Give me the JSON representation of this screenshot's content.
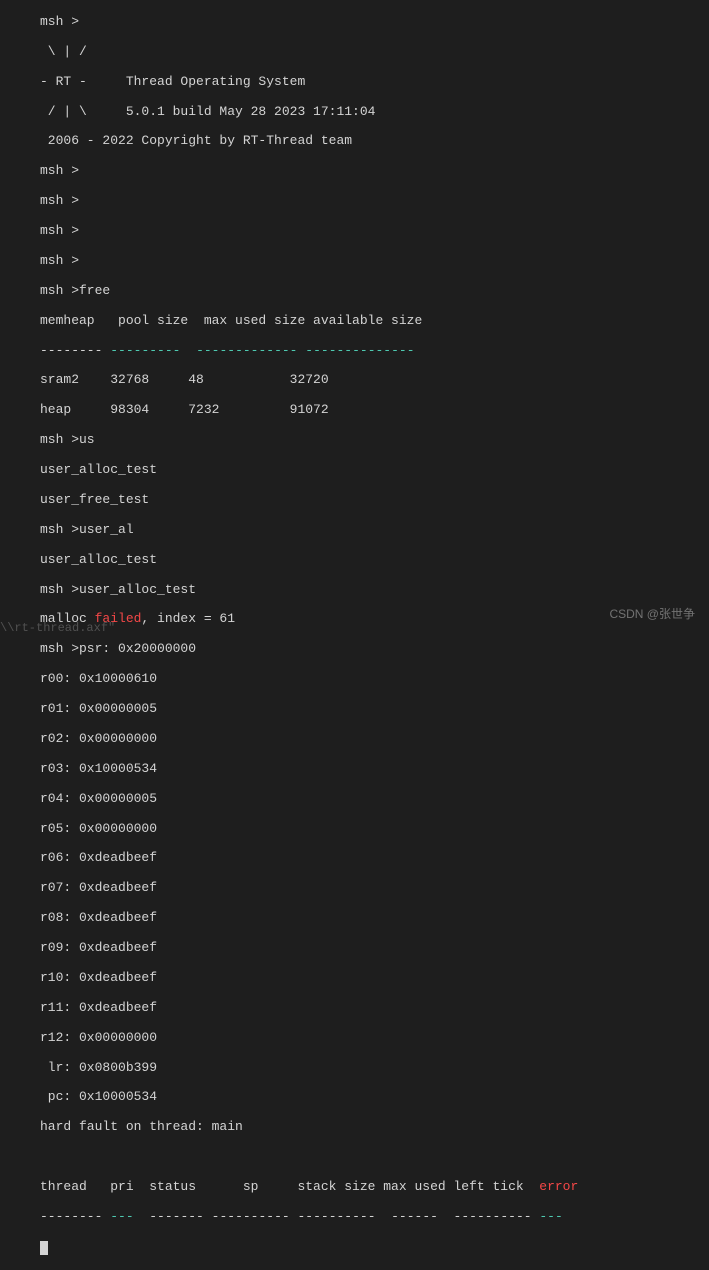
{
  "banner": {
    "l1": "msh >",
    "l2": " \\ | /",
    "l3": "- RT -     Thread Operating System",
    "l4": " / | \\     5.0.1 build May 28 2023 17:11:04",
    "l5": " 2006 - 2022 Copyright by RT-Thread team"
  },
  "prompts": {
    "p1": "msh >",
    "p2": "msh >",
    "p3": "msh >",
    "p4": "msh >",
    "p5": "msh >free"
  },
  "free": {
    "header": "memheap   pool size  max used size available size",
    "sep": {
      "a": "--------",
      "b": "---------",
      "c": "-------------",
      "d": "--------------"
    },
    "r1": "sram2    32768     48           32720",
    "r2": "heap     98304     7232         91072"
  },
  "us": {
    "cmd": "msh >us",
    "l1": "user_alloc_test",
    "l2": "user_free_test",
    "l3": "msh >user_al",
    "l4": "user_alloc_test",
    "l5": "msh >user_alloc_test"
  },
  "malloc": {
    "pre": "malloc ",
    "failed": "failed",
    "post": ", index = 61"
  },
  "regs": {
    "psr": "msh >psr: 0x20000000",
    "r00": "r00: 0x10000610",
    "r01": "r01: 0x00000005",
    "r02": "r02: 0x00000000",
    "r03": "r03: 0x10000534",
    "r04": "r04: 0x00000005",
    "r05": "r05: 0x00000000",
    "r06": "r06: 0xdeadbeef",
    "r07": "r07: 0xdeadbeef",
    "r08": "r08: 0xdeadbeef",
    "r09": "r09: 0xdeadbeef",
    "r10": "r10: 0xdeadbeef",
    "r11": "r11: 0xdeadbeef",
    "r12": "r12: 0x00000000",
    "lr": " lr: 0x0800b399",
    "pc": " pc: 0x10000534"
  },
  "fault": "hard fault on thread: main",
  "thread_table": {
    "header": {
      "pre": "thread   pri  status      sp     stack size max used left tick  ",
      "err": "error"
    },
    "sep": {
      "a": "--------",
      "b": "---",
      "c": "-------",
      "d": "----------",
      "e": "----------",
      "f": "------",
      "g": "----------",
      "h": "---"
    }
  },
  "bottom": "\\\\rt-thread.axf\"",
  "watermark": "CSDN @张世争"
}
